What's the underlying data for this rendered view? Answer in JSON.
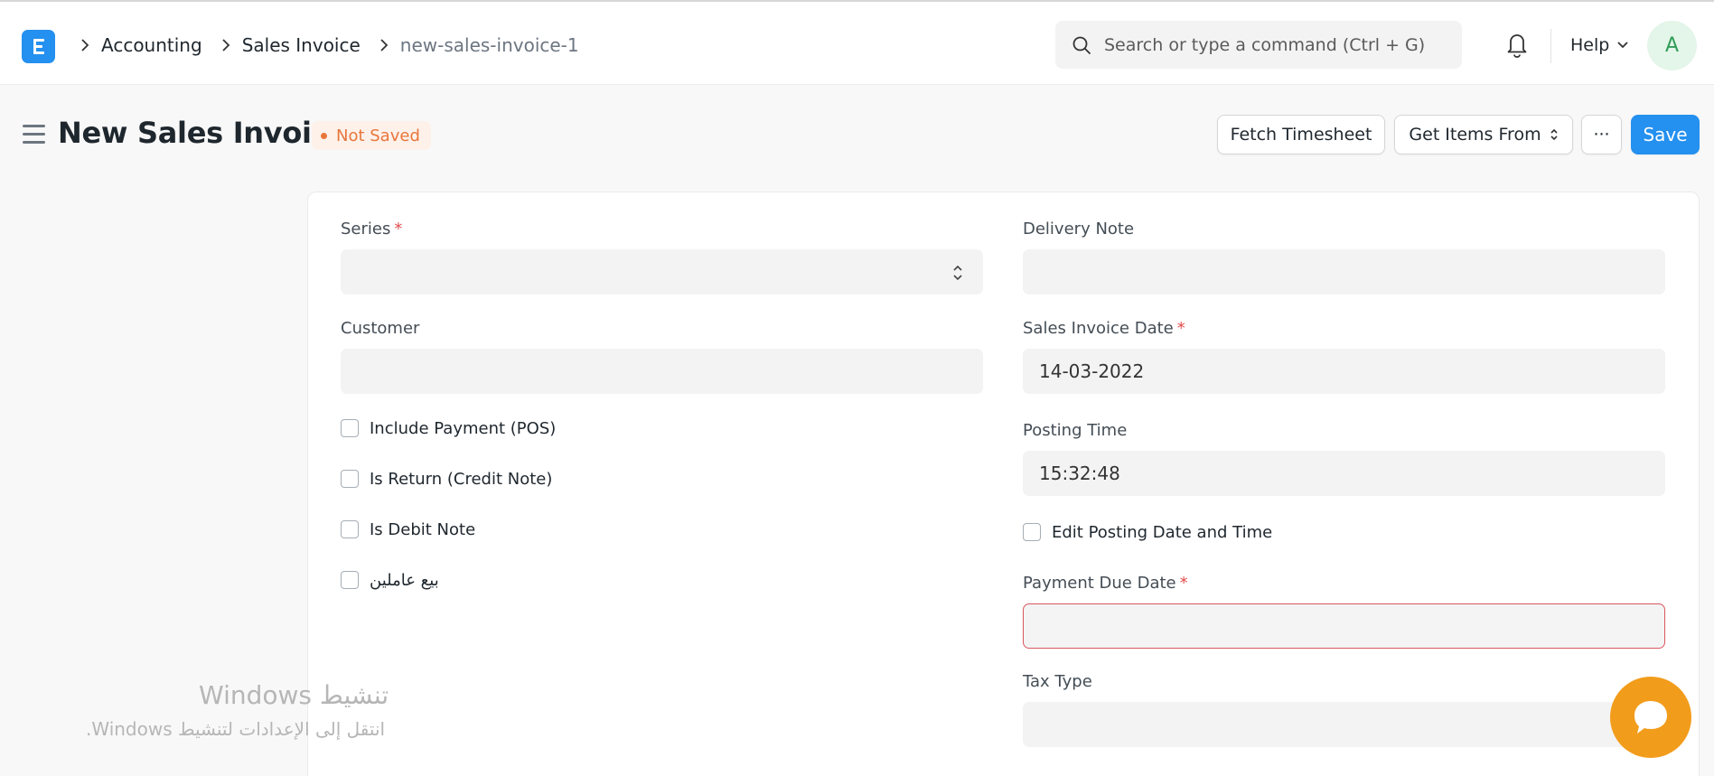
{
  "navbar": {
    "logo_letter": "E",
    "breadcrumbs": [
      {
        "label": "Accounting"
      },
      {
        "label": "Sales Invoice"
      },
      {
        "label": "new-sales-invoice-1"
      }
    ],
    "search_placeholder": "Search or type a command (Ctrl + G)",
    "help_label": "Help",
    "avatar_initial": "A"
  },
  "page": {
    "title": "New Sales Invoice",
    "status": "Not Saved",
    "status_color": "#e8763a",
    "buttons": {
      "fetch_timesheet": "Fetch Timesheet",
      "get_items_from": "Get Items From",
      "more": "···",
      "save": "Save"
    },
    "accent_color": "#2490ef"
  },
  "form": {
    "left": {
      "series": {
        "label": "Series",
        "required": "*",
        "value": ""
      },
      "customer": {
        "label": "Customer",
        "value": ""
      },
      "checkboxes": [
        {
          "label": "Include Payment (POS)",
          "checked": false
        },
        {
          "label": "Is Return (Credit Note)",
          "checked": false
        },
        {
          "label": "Is Debit Note",
          "checked": false
        },
        {
          "label": "بيع عاملين",
          "checked": false
        }
      ]
    },
    "right": {
      "delivery_note": {
        "label": "Delivery Note",
        "value": ""
      },
      "sales_invoice_date": {
        "label": "Sales Invoice Date",
        "required": "*",
        "value": "14-03-2022"
      },
      "posting_time": {
        "label": "Posting Time",
        "value": "15:32:48"
      },
      "edit_posting": {
        "label": "Edit Posting Date and Time",
        "checked": false
      },
      "payment_due_date": {
        "label": "Payment Due Date",
        "required": "*",
        "value": ""
      },
      "tax_type": {
        "label": "Tax Type",
        "value": ""
      }
    }
  },
  "watermark": {
    "line1": "تنشيط Windows",
    "line2": "انتقل إلى الإعدادات لتنشيط Windows."
  },
  "icons": [
    "logo-icon",
    "chevron-right-icon",
    "search-icon",
    "bell-icon",
    "chevron-down-icon",
    "hamburger-icon",
    "sort-arrows-icon",
    "chat-icon"
  ]
}
